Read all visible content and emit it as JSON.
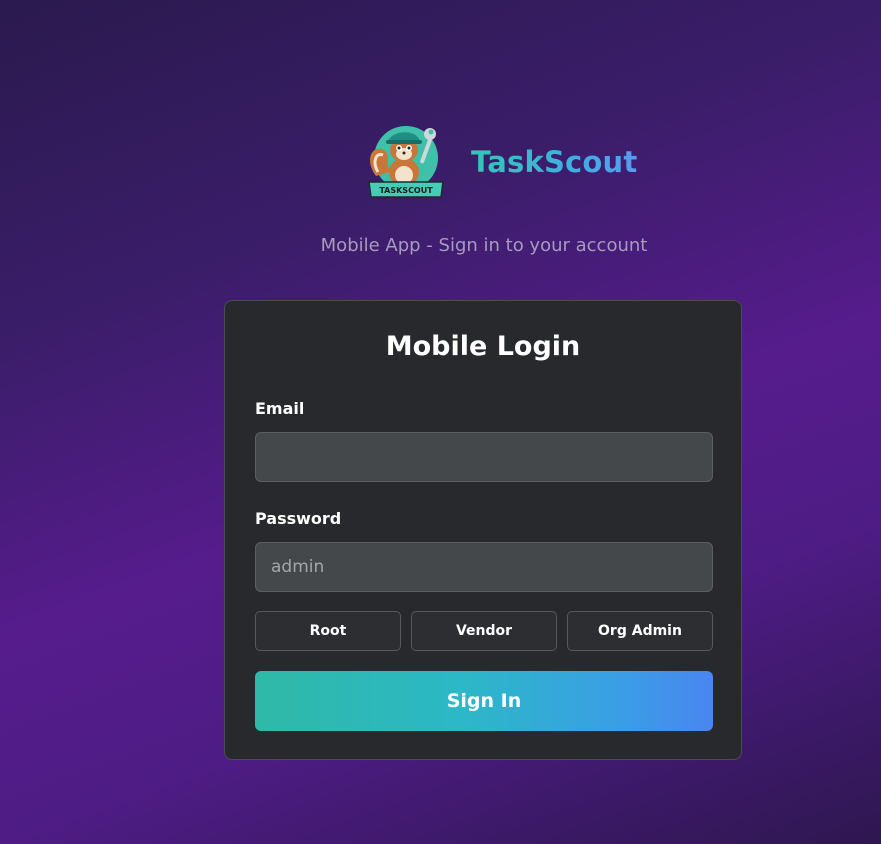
{
  "brand": {
    "name": "TaskScout",
    "logo_text": "TASKSCOUT",
    "logo_icon": "squirrel-mascot-with-wrench"
  },
  "subtitle": "Mobile App - Sign in to your account",
  "login": {
    "title": "Mobile Login",
    "email_label": "Email",
    "email_value": "",
    "email_placeholder": "",
    "password_label": "Password",
    "password_placeholder": "admin",
    "quick_logins": [
      "Root",
      "Vendor",
      "Org Admin"
    ],
    "submit_label": "Sign In"
  },
  "colors": {
    "accent_start": "#2fb9a7",
    "accent_end": "#4a85f0",
    "card_bg": "#27292c",
    "input_bg": "#45484b"
  }
}
